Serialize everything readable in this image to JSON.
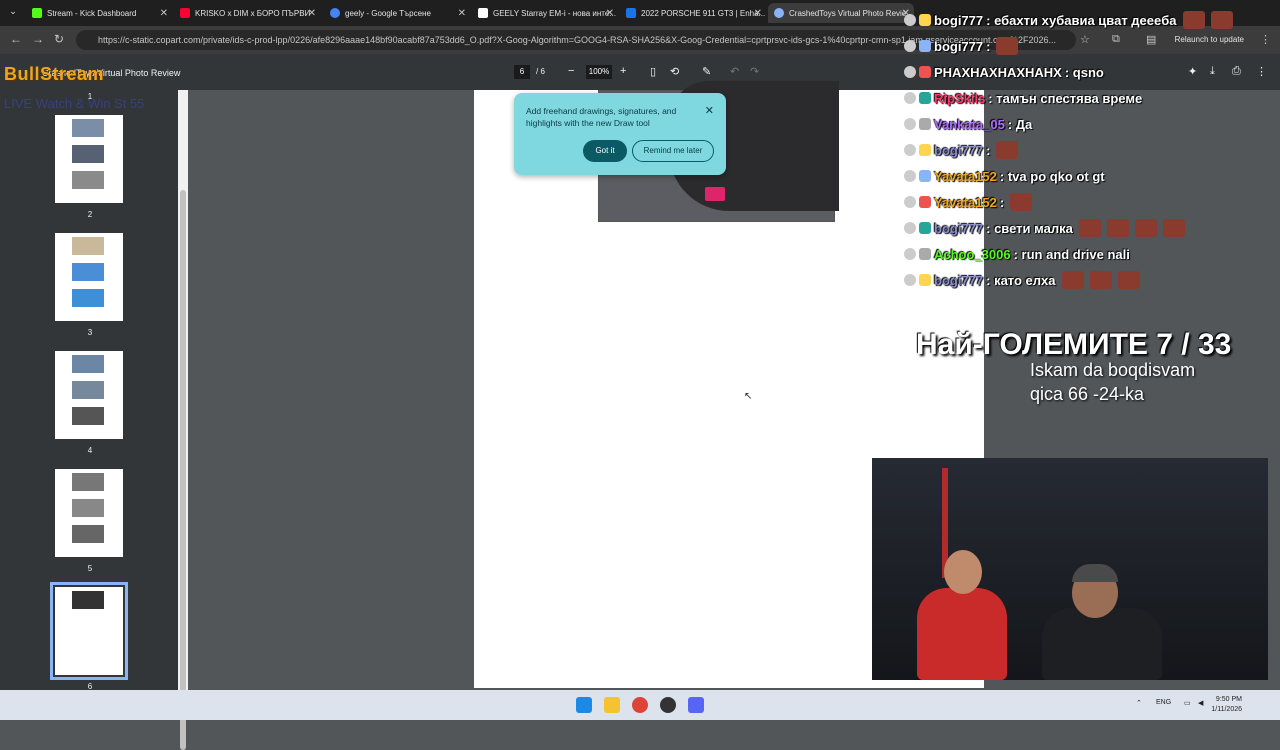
{
  "browser": {
    "tabs": [
      {
        "label": "Stream - Kick Dashboard",
        "fav_color": "#53fc18"
      },
      {
        "label": "KRISKO x DIM x БОРО ПЪРВИ",
        "fav_color": "#ff0033"
      },
      {
        "label": "geely - Google Търсене",
        "fav_color": "#4285f4"
      },
      {
        "label": "GEELY Starray EM-i - нова инте...",
        "fav_color": "#ffffff"
      },
      {
        "label": "2022 PORSCHE 911 GT3 | Enha...",
        "fav_color": "#1a73e8"
      },
      {
        "label": "CrashedToys Virtual Photo Revie...",
        "fav_color": "#8ab4f8"
      }
    ],
    "url": "https://c-static.copart.com/private/ids-c-prod-lpp/0226/afe8296aaae148bf90acabf87a753dd6_O.pdf?X-Goog-Algorithm=GOOG4-RSA-SHA256&X-Goog-Credential=cprtprsvc-ids-gcs-1%40cprtpr-cmn-sp1.iam.gserviceaccount.com%2F2026...",
    "relaunch_label": "Relaunch to update"
  },
  "pdf": {
    "title": "CrashedToys Virtual Photo Review",
    "page_current": "6",
    "page_total": "/ 6",
    "zoom": "100%",
    "thumb_pages": [
      "1",
      "2",
      "3",
      "4",
      "5",
      "6"
    ]
  },
  "popup": {
    "message": "Add freehand drawings, signatures, and highlights with the new Draw tool",
    "got_it": "Got it",
    "remind": "Remind me later"
  },
  "overlay": {
    "logo": "BullStream",
    "logo_sub": "LIVE Watch & Win St 55"
  },
  "chat": [
    {
      "user": "bogi777",
      "user_color": "#ffffff",
      "text": ": ебахти хубавиа цват дееeба",
      "emotes": 2
    },
    {
      "user": "bogi777",
      "user_color": "#ffffff",
      "text": ":",
      "emotes": 1
    },
    {
      "user": "PHAXHAXHAXHAHX",
      "user_color": "#ffffff",
      "text": ": qsno",
      "emotes": 0
    },
    {
      "user": "RipSkils",
      "user_color": "#ff3b6b",
      "text": ": тамън спестява време",
      "emotes": 0
    },
    {
      "user": "Vankata_05",
      "user_color": "#b06cff",
      "text": ": Да",
      "emotes": 0
    },
    {
      "user": "bogi777",
      "user_color": "#8a8fd0",
      "text": ":",
      "emotes": 1
    },
    {
      "user": "Yavata152",
      "user_color": "#f2a41c",
      "text": ": tva po qko ot gt",
      "emotes": 0
    },
    {
      "user": "Yavata152",
      "user_color": "#f2a41c",
      "text": ":",
      "emotes": 1
    },
    {
      "user": "bogi777",
      "user_color": "#8a8fd0",
      "text": ": свети малка",
      "emotes": 4
    },
    {
      "user": "Achoo_3006",
      "user_color": "#53fc18",
      "text": ": run and drive nali",
      "emotes": 0
    },
    {
      "user": "bogi777",
      "user_color": "#8a8fd0",
      "text": ": като елха",
      "emotes": 3
    }
  ],
  "stream_overlay": {
    "title": "Най-ГОЛЕМИТЕ 7 / 33",
    "message_line1": "Iskam da boqdisvam",
    "message_line2": "qica 66 -24-ka"
  },
  "taskbar": {
    "lang": "ENG",
    "time": "9:50 PM",
    "date": "1/11/2026"
  }
}
